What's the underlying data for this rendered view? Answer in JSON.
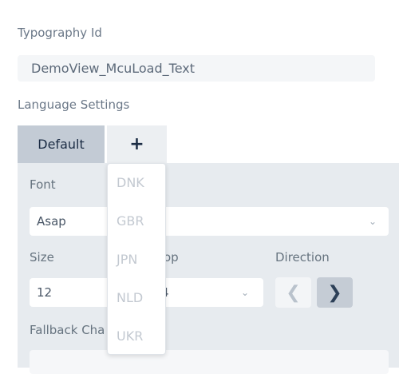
{
  "typography": {
    "label": "Typography Id",
    "value": "DemoView_McuLoad_Text"
  },
  "language_settings": {
    "label": "Language Settings"
  },
  "tabs": {
    "default_label": "Default",
    "add_label": "+"
  },
  "font": {
    "label": "Font",
    "value": "Asap",
    "chevron": "⌄"
  },
  "size": {
    "label": "Size",
    "value": "12"
  },
  "op": {
    "label": "op",
    "value": "4",
    "chevron": "⌄"
  },
  "direction": {
    "label": "Direction",
    "left_glyph": "❮",
    "right_glyph": "❯"
  },
  "fallback": {
    "label": "Fallback Cha"
  },
  "language_dropdown": {
    "options": [
      "DNK",
      "GBR",
      "JPN",
      "NLD",
      "UKR"
    ]
  }
}
